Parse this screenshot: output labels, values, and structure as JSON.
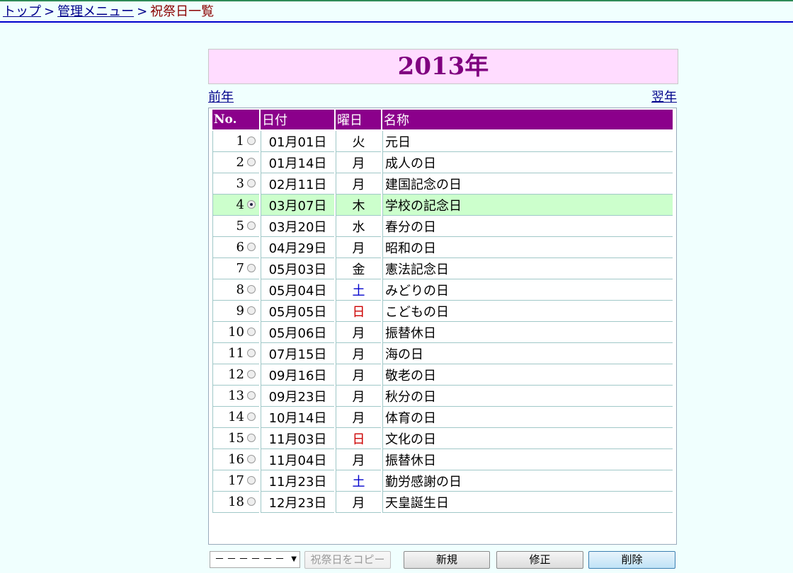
{
  "breadcrumb": {
    "home": "トップ",
    "sep1": ">",
    "admin": "管理メニュー",
    "sep2": ">",
    "current": "祝祭日一覧"
  },
  "year_title": "2013年",
  "nav": {
    "prev": "前年",
    "next": "翌年"
  },
  "table": {
    "headers": {
      "no": "No.",
      "date": "日付",
      "dow": "曜日",
      "name": "名称"
    },
    "rows": [
      {
        "no": "1",
        "date": "01月01日",
        "dow": "火",
        "name": "元日"
      },
      {
        "no": "2",
        "date": "01月14日",
        "dow": "月",
        "name": "成人の日"
      },
      {
        "no": "3",
        "date": "02月11日",
        "dow": "月",
        "name": "建国記念の日"
      },
      {
        "no": "4",
        "date": "03月07日",
        "dow": "木",
        "name": "学校の記念日"
      },
      {
        "no": "5",
        "date": "03月20日",
        "dow": "水",
        "name": "春分の日"
      },
      {
        "no": "6",
        "date": "04月29日",
        "dow": "月",
        "name": "昭和の日"
      },
      {
        "no": "7",
        "date": "05月03日",
        "dow": "金",
        "name": "憲法記念日"
      },
      {
        "no": "8",
        "date": "05月04日",
        "dow": "土",
        "name": "みどりの日"
      },
      {
        "no": "9",
        "date": "05月05日",
        "dow": "日",
        "name": "こどもの日"
      },
      {
        "no": "10",
        "date": "05月06日",
        "dow": "月",
        "name": "振替休日"
      },
      {
        "no": "11",
        "date": "07月15日",
        "dow": "月",
        "name": "海の日"
      },
      {
        "no": "12",
        "date": "09月16日",
        "dow": "月",
        "name": "敬老の日"
      },
      {
        "no": "13",
        "date": "09月23日",
        "dow": "月",
        "name": "秋分の日"
      },
      {
        "no": "14",
        "date": "10月14日",
        "dow": "月",
        "name": "体育の日"
      },
      {
        "no": "15",
        "date": "11月03日",
        "dow": "日",
        "name": "文化の日"
      },
      {
        "no": "16",
        "date": "11月04日",
        "dow": "月",
        "name": "振替休日"
      },
      {
        "no": "17",
        "date": "11月23日",
        "dow": "土",
        "name": "勤労感謝の日"
      },
      {
        "no": "18",
        "date": "12月23日",
        "dow": "月",
        "name": "天皇誕生日"
      }
    ],
    "selected_no": "4"
  },
  "footer": {
    "year_select_value": "－－－－－－",
    "copy_button": "祝祭日をコピー",
    "new_button": "新規",
    "edit_button": "修正",
    "delete_button": "削除"
  },
  "colors": {
    "header_bg": "#8b008b",
    "year_text": "#800080",
    "selected_row": "#ccffcc",
    "saturday": "#0000cc",
    "sunday": "#cc0000"
  }
}
